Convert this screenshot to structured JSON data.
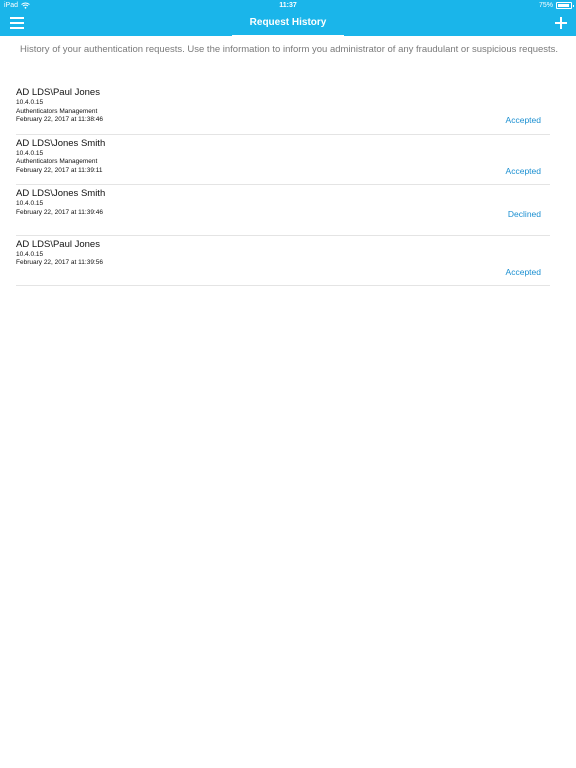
{
  "status_bar": {
    "device": "iPad",
    "time": "11:37",
    "battery_text": "75%",
    "battery_level": 0.75
  },
  "nav": {
    "title": "Request History",
    "menu_icon": "hamburger-icon",
    "add_icon": "plus-icon"
  },
  "intro_text": "History of your authentication requests. Use the information to inform you administrator of any fraudulant or suspicious requests.",
  "requests": [
    {
      "user": "AD LDS\\Paul Jones",
      "ip": "10.4.0.15",
      "app": "Authenticators Management",
      "datetime": "February 22, 2017 at 11:38:46",
      "status": "Accepted"
    },
    {
      "user": "AD LDS\\Jones Smith",
      "ip": "10.4.0.15",
      "app": "Authenticators Management",
      "datetime": "February 22, 2017 at 11:39:11",
      "status": "Accepted"
    },
    {
      "user": "AD LDS\\Jones Smith",
      "ip": "10.4.0.15",
      "app": "",
      "datetime": "February 22, 2017 at 11:39:46",
      "status": "Declined"
    },
    {
      "user": "AD LDS\\Paul Jones",
      "ip": "10.4.0.15",
      "app": "",
      "datetime": "February 22, 2017 at 11:39:56",
      "status": "Accepted"
    }
  ],
  "colors": {
    "accent": "#1ab5ea",
    "status_link": "#1a8fd1"
  }
}
